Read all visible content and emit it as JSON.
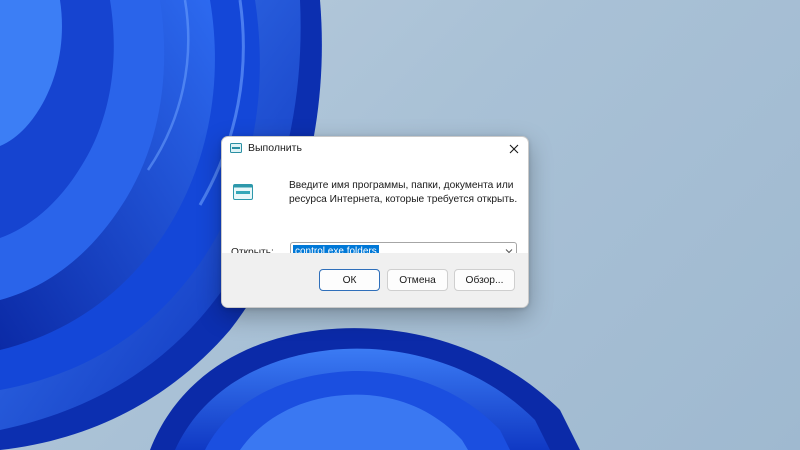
{
  "dialog": {
    "title": "Выполнить",
    "description": "Введите имя программы, папки, документа или ресурса Интернета, которые требуется открыть.",
    "open_label_underlined": "О",
    "open_label_rest": "ткрыть:",
    "input_value": "control.exe folders",
    "buttons": {
      "ok": "ОК",
      "cancel": "Отмена",
      "browse": "Обзор..."
    }
  },
  "icons": {
    "title": "run-app-icon",
    "close": "close-icon",
    "app": "run-app-icon",
    "dropdown": "chevron-down-icon"
  },
  "colors": {
    "accent": "#0078d7",
    "wallpaper_blue": "#1f56e0",
    "sky": "#b2c8da"
  }
}
